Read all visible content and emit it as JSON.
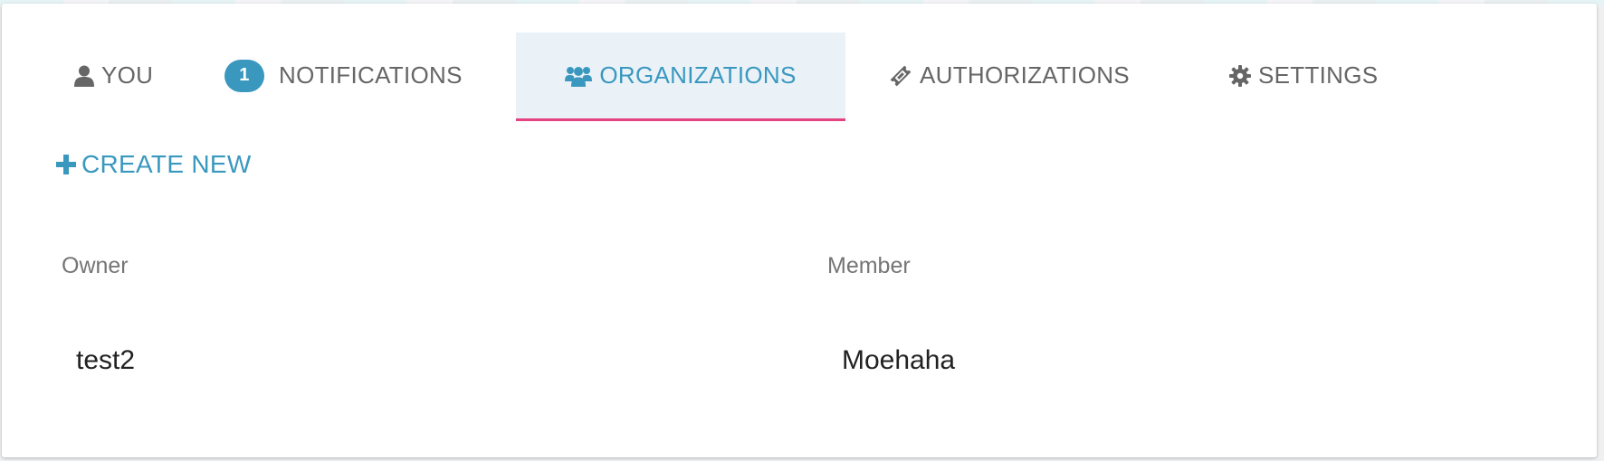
{
  "tabs": {
    "you": {
      "label": "YOU",
      "icon": "user-icon"
    },
    "notifications": {
      "label": "NOTIFICATIONS",
      "badge": "1"
    },
    "organizations": {
      "label": "ORGANIZATIONS",
      "icon": "users-icon",
      "active": true
    },
    "authorizations": {
      "label": "AUTHORIZATIONS",
      "icon": "ticket-icon"
    },
    "settings": {
      "label": "SETTINGS",
      "icon": "gear-icon"
    }
  },
  "actions": {
    "create_new": {
      "label": "CREATE NEW",
      "icon": "plus-icon"
    }
  },
  "columns": {
    "owner": {
      "header": "Owner",
      "items": [
        "test2"
      ]
    },
    "member": {
      "header": "Member",
      "items": [
        "Moehaha"
      ]
    }
  },
  "colors": {
    "accent": "#3a98bf",
    "active_tab_bg": "#eaf2f8",
    "active_tab_underline": "#e5437f",
    "tab_text": "#666666"
  }
}
